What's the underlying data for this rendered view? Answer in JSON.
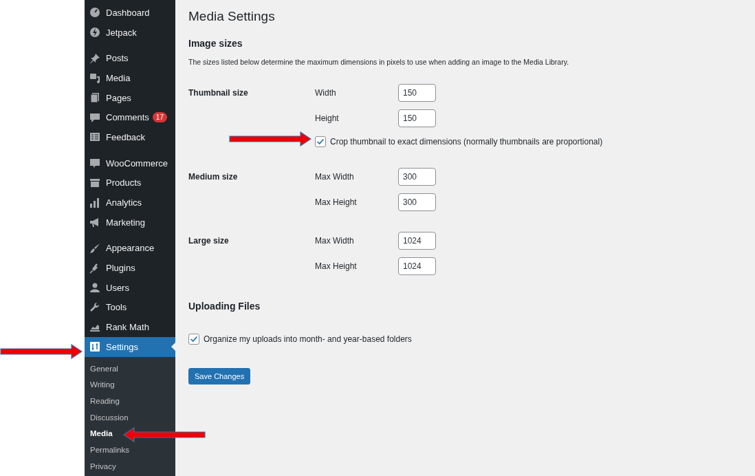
{
  "sidebar": {
    "groups": [
      {
        "items": [
          {
            "label": "Dashboard",
            "selected": false
          },
          {
            "label": "Jetpack",
            "selected": false
          }
        ]
      },
      {
        "items": [
          {
            "label": "Posts",
            "selected": false
          },
          {
            "label": "Media",
            "selected": false
          },
          {
            "label": "Pages",
            "selected": false
          },
          {
            "label": "Comments",
            "selected": false,
            "badge": "17"
          },
          {
            "label": "Feedback",
            "selected": false
          }
        ]
      },
      {
        "items": [
          {
            "label": "WooCommerce",
            "selected": false
          },
          {
            "label": "Products",
            "selected": false
          },
          {
            "label": "Analytics",
            "selected": false
          },
          {
            "label": "Marketing",
            "selected": false
          }
        ]
      },
      {
        "items": [
          {
            "label": "Appearance",
            "selected": false
          },
          {
            "label": "Plugins",
            "selected": false
          },
          {
            "label": "Users",
            "selected": false
          },
          {
            "label": "Tools",
            "selected": false
          },
          {
            "label": "Rank Math",
            "selected": false
          },
          {
            "label": "Settings",
            "selected": true
          }
        ]
      }
    ],
    "submenu": [
      {
        "label": "General",
        "selected": false
      },
      {
        "label": "Writing",
        "selected": false
      },
      {
        "label": "Reading",
        "selected": false
      },
      {
        "label": "Discussion",
        "selected": false
      },
      {
        "label": "Media",
        "selected": true
      },
      {
        "label": "Permalinks",
        "selected": false
      },
      {
        "label": "Privacy",
        "selected": false
      }
    ]
  },
  "page": {
    "title": "Media Settings",
    "image_sizes": {
      "heading": "Image sizes",
      "description": "The sizes listed below determine the maximum dimensions in pixels to use when adding an image to the Media Library.",
      "rows": [
        {
          "label": "Thumbnail size",
          "fields": [
            {
              "label": "Width",
              "value": "150"
            },
            {
              "label": "Height",
              "value": "150"
            }
          ],
          "checkbox": {
            "label": "Crop thumbnail to exact dimensions (normally thumbnails are proportional)",
            "checked": true
          }
        },
        {
          "label": "Medium size",
          "fields": [
            {
              "label": "Max Width",
              "value": "300"
            },
            {
              "label": "Max Height",
              "value": "300"
            }
          ]
        },
        {
          "label": "Large size",
          "fields": [
            {
              "label": "Max Width",
              "value": "1024"
            },
            {
              "label": "Max Height",
              "value": "1024"
            }
          ]
        }
      ]
    },
    "uploading": {
      "heading": "Uploading Files",
      "checkbox": {
        "label": "Organize my uploads into month- and year-based folders",
        "checked": true
      }
    },
    "save_button": "Save Changes"
  },
  "annotations": [
    {
      "kind": "right"
    },
    {
      "kind": "right"
    },
    {
      "kind": "left"
    }
  ]
}
